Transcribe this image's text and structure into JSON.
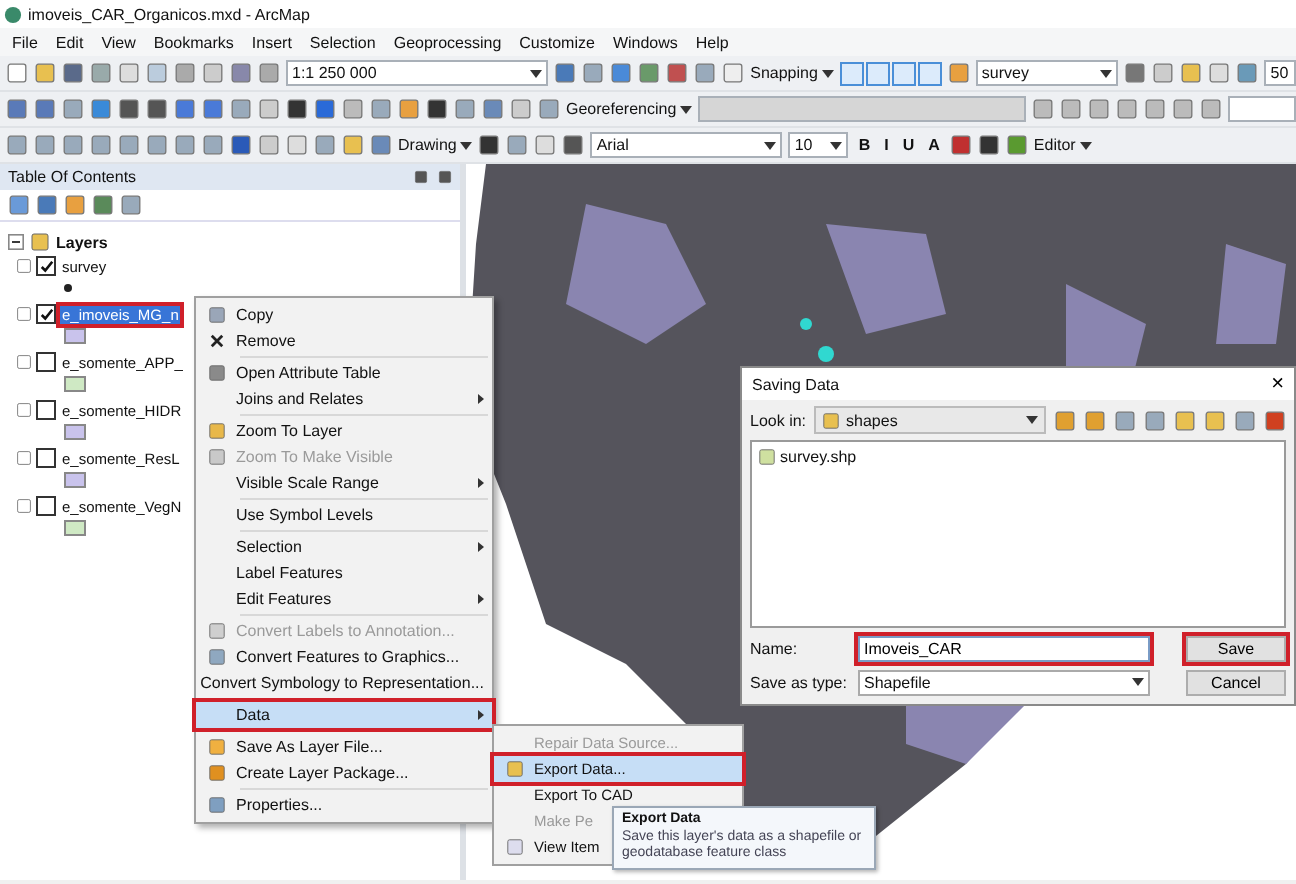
{
  "window": {
    "title": "imoveis_CAR_Organicos.mxd - ArcMap"
  },
  "menu": [
    "File",
    "Edit",
    "View",
    "Bookmarks",
    "Insert",
    "Selection",
    "Geoprocessing",
    "Customize",
    "Windows",
    "Help"
  ],
  "toolbars": {
    "scale": "1:1 250 000",
    "snapping": "Snapping",
    "target_layer": "survey",
    "zoom_value": "50",
    "georeferencing": "Georeferencing",
    "drawing": "Drawing",
    "font": "Arial",
    "font_size": "10",
    "format_buttons": [
      "B",
      "I",
      "U",
      "A"
    ],
    "editor": "Editor"
  },
  "toc": {
    "title": "Table Of Contents",
    "root": {
      "label": "Layers",
      "expanded": true,
      "children": [
        {
          "label": "survey",
          "checked": true,
          "selected": false,
          "annotated": false,
          "kind": "point",
          "color": "#222222"
        },
        {
          "label": "e_imoveis_MG_n",
          "checked": true,
          "selected": true,
          "annotated": true,
          "kind": "fill",
          "color": "#c9c3ec"
        },
        {
          "label": "e_somente_APP_",
          "checked": false,
          "selected": false,
          "annotated": false,
          "kind": "fill",
          "color": "#cfe9c4"
        },
        {
          "label": "e_somente_HIDR",
          "checked": false,
          "selected": false,
          "annotated": false,
          "kind": "fill",
          "color": "#c9c3ec"
        },
        {
          "label": "e_somente_ResL",
          "checked": false,
          "selected": false,
          "annotated": false,
          "kind": "fill",
          "color": "#c9c3ec"
        },
        {
          "label": "e_somente_VegN",
          "checked": false,
          "selected": false,
          "annotated": false,
          "kind": "fill",
          "color": "#cfe9c4"
        }
      ]
    }
  },
  "context_menu": {
    "items": [
      {
        "kind": "item",
        "label": "Copy",
        "disabled": false,
        "submenu": false,
        "selected": false,
        "annotated": false
      },
      {
        "kind": "item",
        "label": "Remove",
        "disabled": false,
        "submenu": false,
        "selected": false,
        "annotated": false
      },
      {
        "kind": "separator"
      },
      {
        "kind": "item",
        "label": "Open Attribute Table",
        "disabled": false,
        "submenu": false,
        "selected": false,
        "annotated": false
      },
      {
        "kind": "item",
        "label": "Joins and Relates",
        "disabled": false,
        "submenu": true,
        "selected": false,
        "annotated": false
      },
      {
        "kind": "separator"
      },
      {
        "kind": "item",
        "label": "Zoom To Layer",
        "disabled": false,
        "submenu": false,
        "selected": false,
        "annotated": false
      },
      {
        "kind": "item",
        "label": "Zoom To Make Visible",
        "disabled": true,
        "submenu": false,
        "selected": false,
        "annotated": false
      },
      {
        "kind": "item",
        "label": "Visible Scale Range",
        "disabled": false,
        "submenu": true,
        "selected": false,
        "annotated": false
      },
      {
        "kind": "separator"
      },
      {
        "kind": "item",
        "label": "Use Symbol Levels",
        "disabled": false,
        "submenu": false,
        "selected": false,
        "annotated": false
      },
      {
        "kind": "separator"
      },
      {
        "kind": "item",
        "label": "Selection",
        "disabled": false,
        "submenu": true,
        "selected": false,
        "annotated": false
      },
      {
        "kind": "item",
        "label": "Label Features",
        "disabled": false,
        "submenu": false,
        "selected": false,
        "annotated": false
      },
      {
        "kind": "item",
        "label": "Edit Features",
        "disabled": false,
        "submenu": true,
        "selected": false,
        "annotated": false
      },
      {
        "kind": "separator"
      },
      {
        "kind": "item",
        "label": "Convert Labels to Annotation...",
        "disabled": true,
        "submenu": false,
        "selected": false,
        "annotated": false
      },
      {
        "kind": "item",
        "label": "Convert Features to Graphics...",
        "disabled": false,
        "submenu": false,
        "selected": false,
        "annotated": false
      },
      {
        "kind": "item",
        "label": "Convert Symbology to Representation...",
        "disabled": false,
        "submenu": false,
        "selected": false,
        "annotated": false
      },
      {
        "kind": "separator"
      },
      {
        "kind": "item",
        "label": "Data",
        "disabled": false,
        "submenu": true,
        "selected": true,
        "annotated": true
      },
      {
        "kind": "separator"
      },
      {
        "kind": "item",
        "label": "Save As Layer File...",
        "disabled": false,
        "submenu": false,
        "selected": false,
        "annotated": false
      },
      {
        "kind": "item",
        "label": "Create Layer Package...",
        "disabled": false,
        "submenu": false,
        "selected": false,
        "annotated": false
      },
      {
        "kind": "separator"
      },
      {
        "kind": "item",
        "label": "Properties...",
        "disabled": false,
        "submenu": false,
        "selected": false,
        "annotated": false
      }
    ]
  },
  "data_submenu": {
    "items": [
      {
        "label": "Repair Data Source...",
        "disabled": true,
        "selected": false,
        "annotated": false
      },
      {
        "label": "Export Data...",
        "disabled": false,
        "selected": true,
        "annotated": true
      },
      {
        "label": "Export To CAD",
        "disabled": false,
        "selected": false,
        "annotated": false
      },
      {
        "label": "Make Pe",
        "disabled": true,
        "selected": false,
        "annotated": false
      },
      {
        "label": "View Item",
        "disabled": false,
        "selected": false,
        "annotated": false
      }
    ]
  },
  "tooltip": {
    "title": "Export Data",
    "text": "Save this layer's data as a shapefile or geodatabase feature class"
  },
  "dialog": {
    "title": "Saving Data",
    "close": "×",
    "look_in_label": "Look in:",
    "look_in": "shapes",
    "files": [
      "survey.shp"
    ],
    "name_label": "Name:",
    "name": "Imoveis_CAR",
    "name_annotated": true,
    "type_label": "Save as type:",
    "type": "Shapefile",
    "buttons": [
      {
        "label": "Save",
        "annotated": true
      },
      {
        "label": "Cancel",
        "annotated": false
      }
    ]
  }
}
